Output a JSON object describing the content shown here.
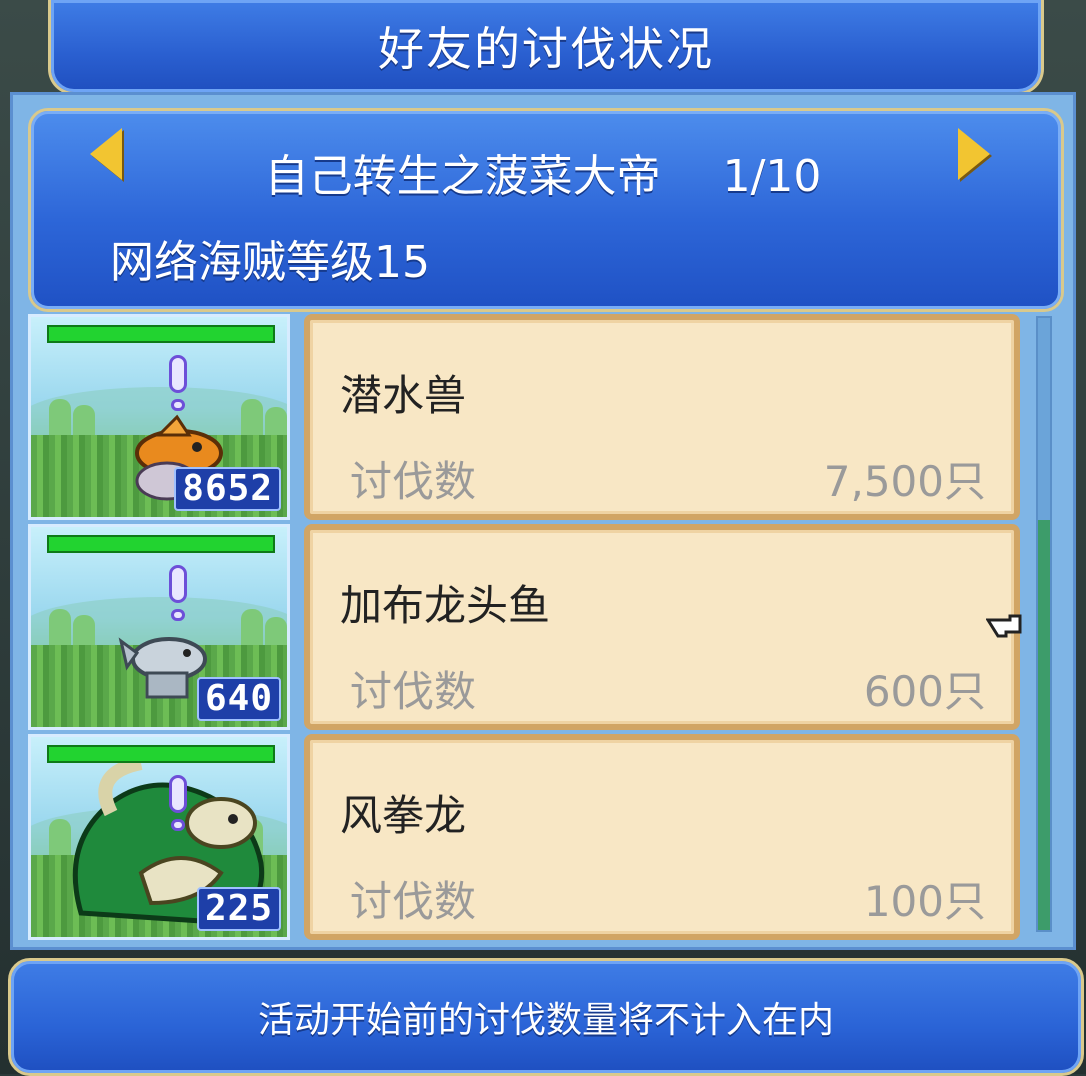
{
  "window": {
    "title": "好友的讨伐状况"
  },
  "header": {
    "friend_name": "自己转生之菠菜大帝",
    "page_indicator": "1/10",
    "pirate_level": "网络海贼等级15"
  },
  "rows": [
    {
      "monster_name": "潜水兽",
      "kill_label": "讨伐数",
      "kill_count": "7,500只",
      "power": "8652",
      "hp_fraction": 1.0
    },
    {
      "monster_name": "加布龙头鱼",
      "kill_label": "讨伐数",
      "kill_count": "600只",
      "power": "640",
      "hp_fraction": 1.0
    },
    {
      "monster_name": "风拳龙",
      "kill_label": "讨伐数",
      "kill_count": "100只",
      "power": "225",
      "hp_fraction": 1.0
    }
  ],
  "footer": {
    "note": "活动开始前的讨伐数量将不计入在内"
  },
  "icons": {
    "prev": "triangle-left-arrow-icon",
    "next": "triangle-right-arrow-icon",
    "alert": "exclamation-icon",
    "cursor": "pointing-hand-icon"
  },
  "colors": {
    "panel_blue": "#2a63d6",
    "card_bg": "#f8e7c5",
    "card_border": "#d1a565",
    "hp_green": "#22d330",
    "arrow_gold": "#f2c531"
  }
}
